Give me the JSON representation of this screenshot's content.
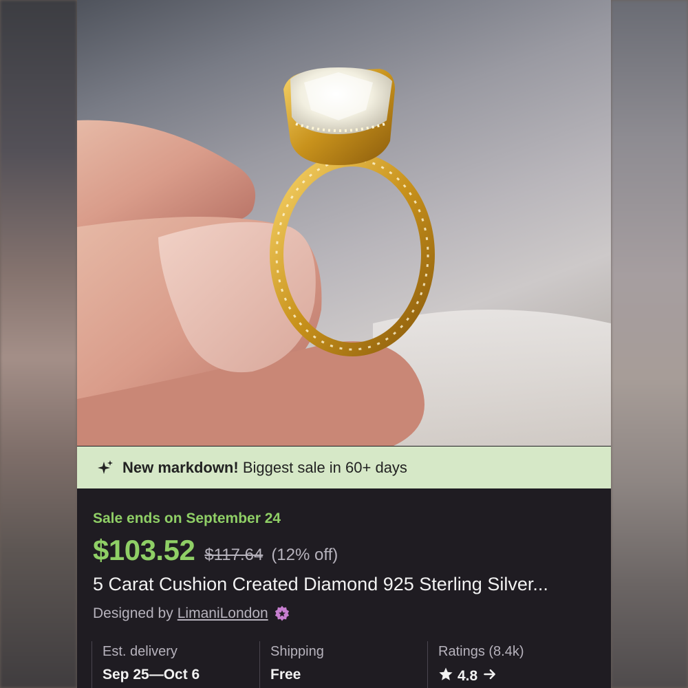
{
  "banner": {
    "icon": "sparkle-icon",
    "bold_text": "New markdown!",
    "text": "Biggest sale in 60+ days"
  },
  "listing": {
    "sale_ends": "Sale ends on September 24",
    "price": "$103.52",
    "original_price": "$117.64",
    "discount": "(12% off)",
    "title": "5 Carat Cushion Created Diamond 925 Sterling Silver...",
    "designed_by_label": "Designed by",
    "shop_name": "LimaniLondon"
  },
  "stats": {
    "delivery_label": "Est. delivery",
    "delivery_value": "Sep 25—Oct 6",
    "shipping_label": "Shipping",
    "shipping_value": "Free",
    "ratings_label": "Ratings (8.4k)",
    "rating_value": "4.8"
  },
  "colors": {
    "accent_green": "#8fcf66",
    "banner_bg": "#d6e8c7",
    "card_bg": "#1f1c22",
    "star_seller_badge": "#c77ed0"
  }
}
